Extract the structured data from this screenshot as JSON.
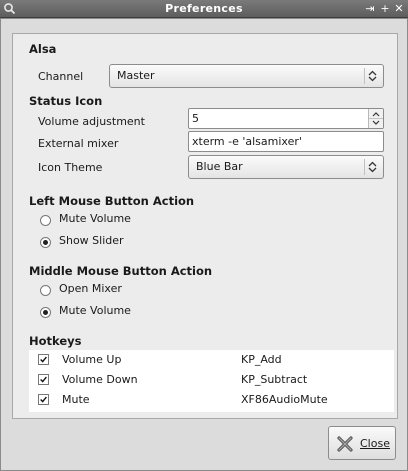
{
  "window": {
    "title": "Preferences",
    "buttons": {
      "menu": "⇥",
      "maximize": "+",
      "close": "✕"
    }
  },
  "alsa": {
    "heading": "Alsa",
    "channel_label": "Channel",
    "channel_value": "Master"
  },
  "status_icon": {
    "heading": "Status Icon",
    "volume_adjustment_label": "Volume adjustment",
    "volume_adjustment_value": "5",
    "external_mixer_label": "External mixer",
    "external_mixer_value": "xterm -e 'alsamixer'",
    "icon_theme_label": "Icon Theme",
    "icon_theme_value": "Blue Bar"
  },
  "left_mouse": {
    "heading": "Left Mouse Button Action",
    "options": [
      {
        "label": "Mute Volume",
        "selected": false
      },
      {
        "label": "Show Slider",
        "selected": true
      }
    ]
  },
  "middle_mouse": {
    "heading": "Middle Mouse Button Action",
    "options": [
      {
        "label": "Open Mixer",
        "selected": false
      },
      {
        "label": "Mute Volume",
        "selected": true
      }
    ]
  },
  "hotkeys": {
    "heading": "Hotkeys",
    "rows": [
      {
        "name": "Volume Up",
        "key": "KP_Add",
        "checked": true
      },
      {
        "name": "Volume Down",
        "key": "KP_Subtract",
        "checked": true
      },
      {
        "name": "Mute",
        "key": "XF86AudioMute",
        "checked": true
      }
    ]
  },
  "footer": {
    "close_label": "Close",
    "close_icon": "close-x-icon"
  }
}
